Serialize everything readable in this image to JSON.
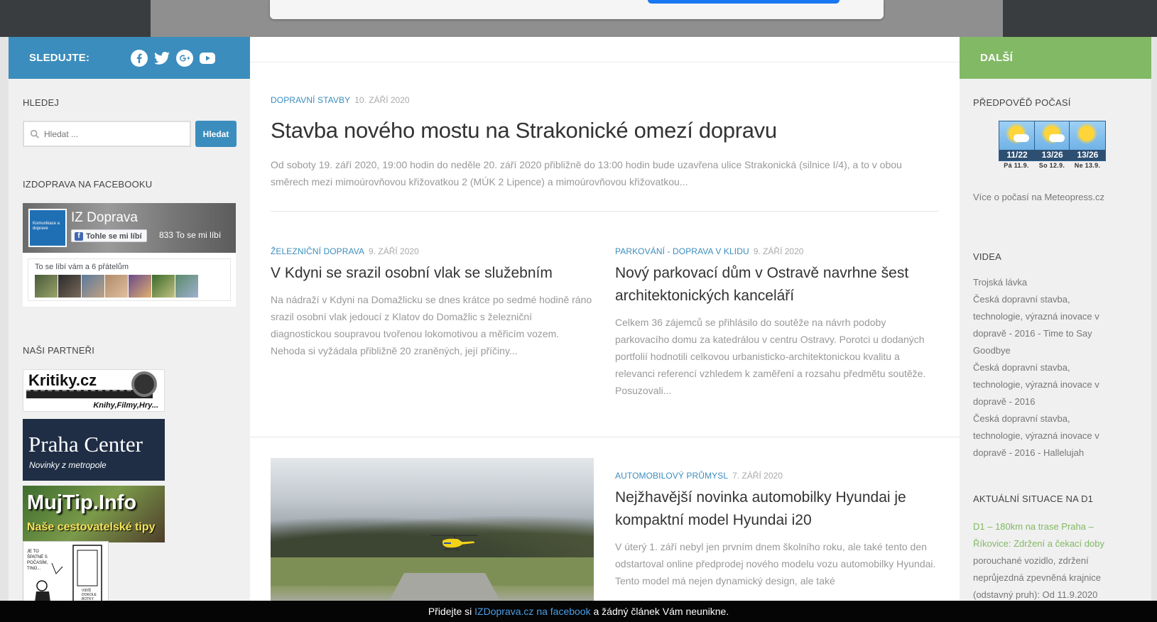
{
  "left": {
    "follow_label": "SLEDUJTE:",
    "social_icons": [
      "facebook-icon",
      "twitter-icon",
      "google-plus-icon",
      "youtube-icon"
    ],
    "search": {
      "title": "HLEDEJ",
      "placeholder": "Hledat ...",
      "button": "Hledat"
    },
    "facebook": {
      "title": "IZDOPRAVA NA FACEBOOKU",
      "page_name": "IZ Doprava",
      "logo_text": "Komunikace a doprave",
      "like_button": "Tohle se mi líbí",
      "like_count": "833 To se mi líbí",
      "friends_text": "To se líbí vám a 6 přátelům"
    },
    "partners": {
      "title": "NAŠI PARTNEŘI",
      "kritiky": {
        "name": "Kritiky.cz",
        "tagline": "Knihy,Filmy,Hry..."
      },
      "praha": {
        "name": "Praha Center",
        "tagline": "Novinky z metropole"
      },
      "mujtip": {
        "name": "MujTip.Info",
        "tagline": "Naše cestovatelské tipy"
      },
      "comic": {
        "text1": "JE TO ŠPATNÉ S POČASÍM, TINO...",
        "text2": "VIDÍŠ DOKOLE BOTKY"
      }
    }
  },
  "main": {
    "featured": {
      "category": "DOPRAVNÍ STAVBY",
      "date": "10. ZÁŘÍ 2020",
      "title": "Stavba nového mostu na Strakonické omezí dopravu",
      "excerpt": "Od soboty 19. září 2020, 19:00 hodin do neděle 20. září 2020 přibližně do 13:00 hodin bude uzavřena ulice Strakonická (silnice I/4), a to v obou směrech mezi mimoúrovňovou křižovatkou 2 (MÚK 2 Lipence) a mimoúrovňovou křižovatkou..."
    },
    "posts": [
      {
        "category": "ŽELEZNIČNÍ DOPRAVA",
        "date": "9. ZÁŘÍ 2020",
        "title": "V Kdyni se srazil osobní vlak se služebním",
        "excerpt": "Na nádraží v Kdyni na Domažlicku se dnes krátce po sedmé hodině ráno srazil osobní vlak jedoucí z Klatov do Domažlic s železniční diagnostickou soupravou tvořenou lokomotivou a měřicím vozem. Nehoda si vyžádala přibližně 20 zraněných, její příčiny..."
      },
      {
        "category": "PARKOVÁNÍ - DOPRAVA V KLIDU",
        "date": "9. ZÁŘÍ 2020",
        "title": "Nový parkovací dům v Ostravě navrhne šest architektonických kanceláří",
        "excerpt": "Celkem 36 zájemců se přihlásilo do soutěže na návrh podoby parkovacího domu za katedrálou v centru Ostravy. Porotci u dodaných portfolií hodnotili celkovou urbanisticko-architektonickou kvalitu a relevanci referencí vzhledem k zaměření a rozsahu předmětu soutěže. Posuzovali..."
      },
      {
        "category": "AUTOMOBILOVÝ PRŮMYSL",
        "date": "7. ZÁŘÍ 2020",
        "title": "Nejžhavější novinka automobilky Hyundai je kompaktní model Hyundai i20",
        "excerpt": "V úterý 1. září nebyl jen prvním dnem školního roku, ale také tento den odstartoval online předprodej nového modelu vozu automobilky Hyundai. Tento model  má nejen dynamický design, ale také"
      }
    ]
  },
  "right": {
    "head": "DALŠÍ",
    "weather": {
      "title": "PŘEDPOVĚĎ POČASÍ",
      "days": [
        {
          "temp": "11/22",
          "label": "Pá 11.9."
        },
        {
          "temp": "13/26",
          "label": "So 12.9."
        },
        {
          "temp": "13/26",
          "label": "Ne 13.9."
        }
      ],
      "link": "Více o počasí na Meteopress.cz"
    },
    "videos": {
      "title": "VIDEA",
      "items": [
        "Trojská lávka",
        "Česká dopravní stavba, technologie, výrazná inovace v dopravě - 2016 - Time to Say Goodbye",
        "Česká dopravní stavba, technologie, výrazná inovace v dopravě - 2016",
        "Česká dopravní stavba, technologie, výrazná inovace v dopravě - 2016 - Hallelujah"
      ]
    },
    "d1": {
      "title": "AKTUÁLNÍ SITUACE NA D1",
      "link": "D1 – 180km na trase Praha – Říkovice: Zdržení a čekací doby",
      "text": "porouchané vozidlo, zdržení neprůjezdná zpevněná krajnice (odstavný pruh): Od 11.9.2020"
    }
  },
  "bottombar": {
    "prefix": "Přidejte si",
    "site": "IZDoprava.cz",
    "link": "na facebook",
    "suffix": "a žádný článek Vám neunikne."
  },
  "colors": {
    "left_head": "#3b8dbd",
    "right_head": "#82b965",
    "accent_link": "#3b8dbd",
    "bottom_link": "#4a9ee6"
  }
}
